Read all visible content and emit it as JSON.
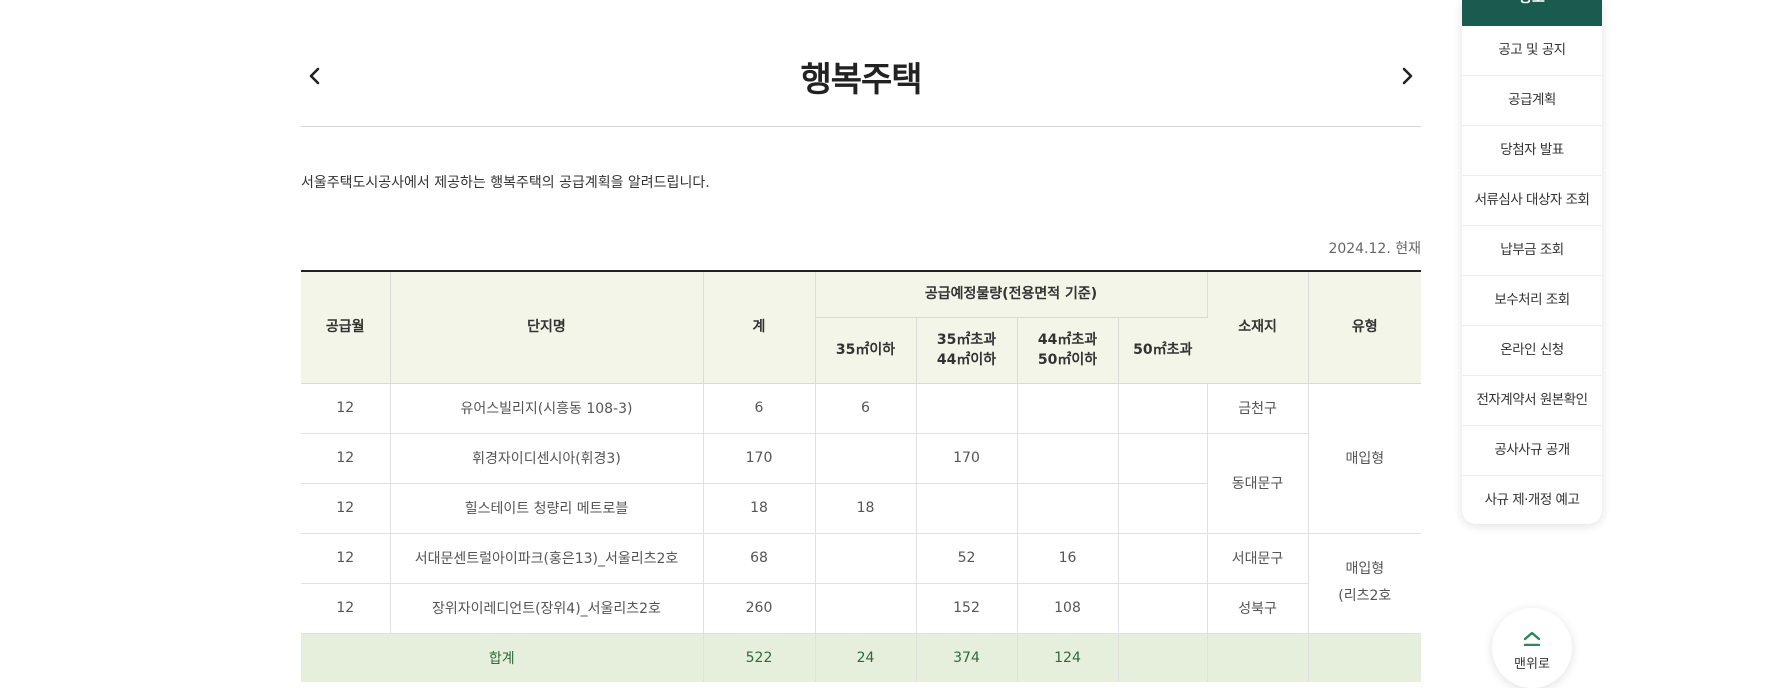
{
  "page": {
    "title": "행복주택",
    "intro": "서울주택도시공사에서 제공하는 행복주택의 공급계획을 알려드립니다.",
    "as_of": "2024.12. 현재"
  },
  "table": {
    "headers": {
      "month": "공급월",
      "complex": "단지명",
      "sum": "계",
      "planned": "공급예정물량(전용면적 기준)",
      "size1": "35㎡이하",
      "size2_line1": "35㎡초과",
      "size2_line2": "44㎡이하",
      "size3_line1": "44㎡초과",
      "size3_line2": "50㎡이하",
      "size4": "50㎡초과",
      "location": "소재지",
      "type": "유형"
    },
    "rows": [
      {
        "month": "12",
        "complex": "유어스빌리지(시흥동 108-3)",
        "sum": "6",
        "s1": "6",
        "s2": "",
        "s3": "",
        "s4": ""
      },
      {
        "month": "12",
        "complex": "휘경자이디센시아(휘경3)",
        "sum": "170",
        "s1": "",
        "s2": "170",
        "s3": "",
        "s4": ""
      },
      {
        "month": "12",
        "complex": "힐스테이트 청량리 메트로블",
        "sum": "18",
        "s1": "18",
        "s2": "",
        "s3": "",
        "s4": ""
      },
      {
        "month": "12",
        "complex": "서대문센트럴아이파크(홍은13)_서울리츠2호",
        "sum": "68",
        "s1": "",
        "s2": "52",
        "s3": "16",
        "s4": ""
      },
      {
        "month": "12",
        "complex": "장위자이레디언트(장위4)_서울리츠2호",
        "sum": "260",
        "s1": "",
        "s2": "152",
        "s3": "108",
        "s4": ""
      }
    ],
    "locations": [
      "금천구",
      "동대문구",
      "서대문구",
      "성북구"
    ],
    "types": {
      "type1": "매입형",
      "type2_line1": "매입형",
      "type2_line2": "(리츠2호"
    },
    "total": {
      "label": "합계",
      "sum": "522",
      "s1": "24",
      "s2": "374",
      "s3": "124"
    }
  },
  "sidebar": {
    "head": "공고",
    "items": [
      "공고 및 공지",
      "공급계획",
      "당첨자 발표",
      "서류심사 대상자 조회",
      "납부금 조회",
      "보수처리 조회",
      "온라인 신청",
      "전자계약서 원본확인",
      "공사사규 공개",
      "사규 제·개정 예고"
    ]
  },
  "to_top": {
    "label": "맨위로"
  },
  "colors": {
    "header_bg": "#f3f5e8",
    "total_bg": "#e6eedc",
    "accent": "#1a5b4f"
  }
}
